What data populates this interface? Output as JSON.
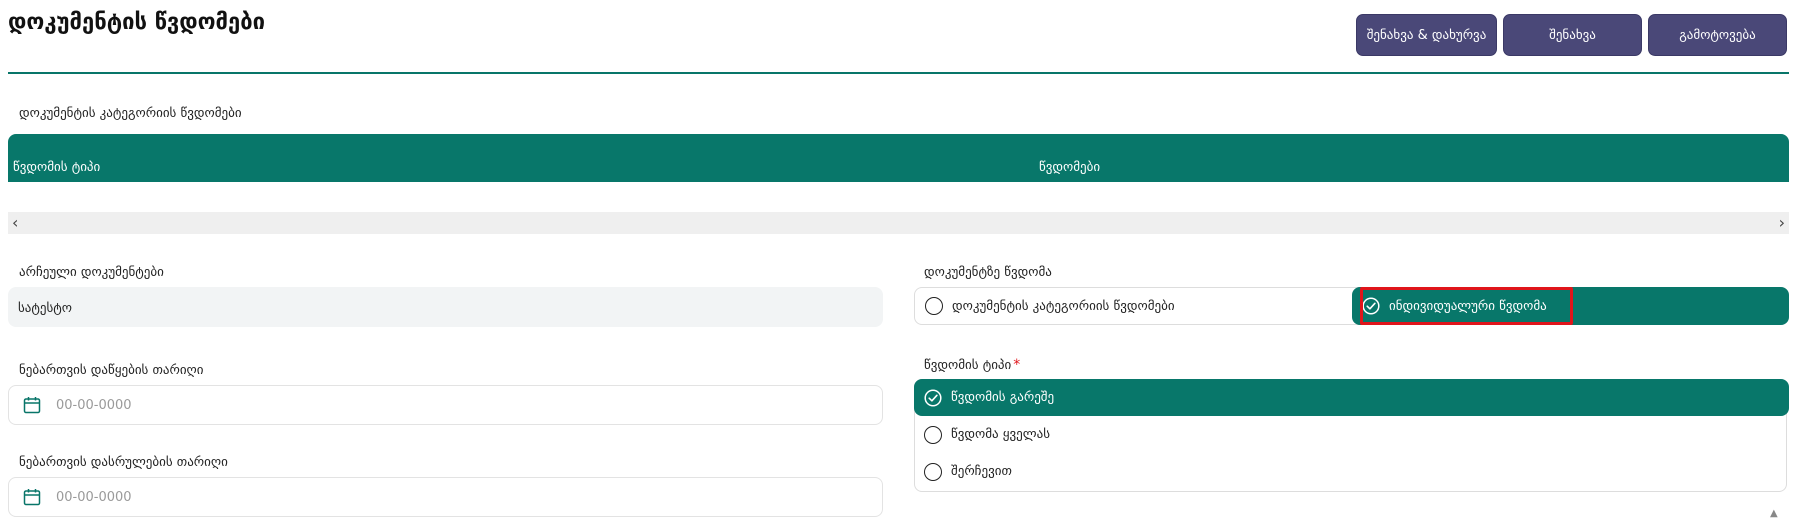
{
  "header": {
    "title": "დოკუმენტის წვდომები",
    "buttons": {
      "save_close": "შენახვა & დახურვა",
      "save": "შენახვა",
      "exit": "გამოტოვება"
    }
  },
  "category_access": {
    "section_label": "დოკუმენტის კატეგორიის წვდომები",
    "columns": [
      "წვდომის ტიპი",
      "წვდომები"
    ],
    "rows": []
  },
  "selected_documents": {
    "label": "არჩეული დოკუმენტები",
    "value": "სატესტო"
  },
  "permission_start": {
    "label": "ნებართვის დაწყების თარიღი",
    "placeholder": "00-00-0000"
  },
  "permission_end": {
    "label": "ნებართვის დასრულების თარიღი",
    "placeholder": "00-00-0000"
  },
  "document_access": {
    "label": "დოკუმენტზე წვდომა",
    "options": [
      "დოკუმენტის კატეგორიის წვდომები",
      "ინდივიდუალური წვდომა"
    ],
    "selected": "ინდივიდუალური წვდომა"
  },
  "access_type": {
    "label": "წვდომის ტიპი",
    "required_mark": "*",
    "options": [
      "წვდომის გარეშე",
      "წვდომა ყველას",
      "შერჩევით"
    ],
    "selected": "წვდომის გარეშე"
  },
  "colors": {
    "accent_teal": "#08776a",
    "button_purple": "#4a4878",
    "highlight_red": "#e0151b"
  }
}
